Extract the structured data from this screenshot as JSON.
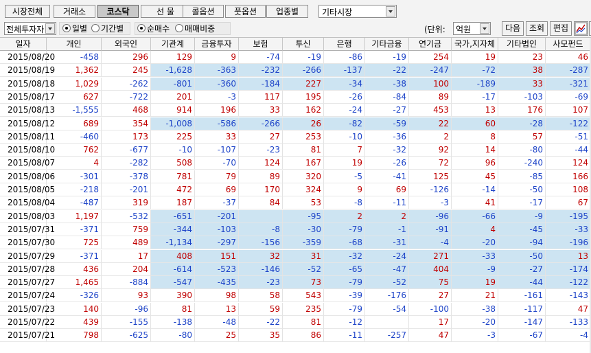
{
  "tabs": [
    "시장전체",
    "거래소",
    "코스닥",
    "선  물",
    "콜옵션",
    "풋옵션",
    "업종별"
  ],
  "active_tab": 2,
  "market_select": "기타시장",
  "investor_select": "전체투자자",
  "period_options": [
    "일별",
    "기간별"
  ],
  "period_selected": 0,
  "measure_options": [
    "순매수",
    "매매비중"
  ],
  "measure_selected": 0,
  "unit_label": "(단위:",
  "unit_select": "억원",
  "buttons": {
    "next": "다음",
    "query": "조회",
    "edit": "편집"
  },
  "icons": [
    "chart-icon",
    "grid-icon"
  ],
  "columns": [
    "일자",
    "개인",
    "외국인",
    "기관계",
    "금융투자",
    "보험",
    "투신",
    "은행",
    "기타금융",
    "연기금",
    "국가,지자체",
    "기타법인",
    "사모펀드"
  ],
  "rows": [
    {
      "date": "2015/08/20",
      "v": [
        "-458",
        "296",
        "129",
        "9",
        "-74",
        "-19",
        "-86",
        "-19",
        "254",
        "19",
        "23",
        "46"
      ],
      "hl": []
    },
    {
      "date": "2015/08/19",
      "v": [
        "1,362",
        "245",
        "-1,628",
        "-363",
        "-232",
        "-266",
        "-137",
        "-22",
        "-247",
        "-72",
        "38",
        "-287"
      ],
      "hl": [
        2,
        3,
        4,
        5,
        6,
        7,
        8,
        9,
        10,
        11
      ]
    },
    {
      "date": "2015/08/18",
      "v": [
        "1,029",
        "-262",
        "-801",
        "-360",
        "-184",
        "227",
        "-34",
        "-38",
        "100",
        "-189",
        "33",
        "-321"
      ],
      "hl": [
        2,
        3,
        4,
        5,
        6,
        7,
        8,
        9,
        10,
        11
      ]
    },
    {
      "date": "2015/08/17",
      "v": [
        "627",
        "-722",
        "201",
        "-3",
        "117",
        "195",
        "-26",
        "-84",
        "89",
        "-17",
        "-103",
        "-69"
      ],
      "hl": []
    },
    {
      "date": "2015/08/13",
      "v": [
        "-1,555",
        "468",
        "914",
        "196",
        "33",
        "162",
        "-24",
        "-27",
        "453",
        "13",
        "176",
        "107"
      ],
      "hl": []
    },
    {
      "date": "2015/08/12",
      "v": [
        "689",
        "354",
        "-1,008",
        "-586",
        "-266",
        "26",
        "-82",
        "-59",
        "22",
        "60",
        "-28",
        "-122"
      ],
      "hl": [
        2,
        3,
        4,
        5,
        6,
        7,
        8,
        9,
        10,
        11
      ]
    },
    {
      "date": "2015/08/11",
      "v": [
        "-460",
        "173",
        "225",
        "33",
        "27",
        "253",
        "-10",
        "-36",
        "2",
        "8",
        "57",
        "-51"
      ],
      "hl": []
    },
    {
      "date": "2015/08/10",
      "v": [
        "762",
        "-677",
        "-10",
        "-107",
        "-23",
        "81",
        "7",
        "-32",
        "92",
        "14",
        "-80",
        "-44"
      ],
      "hl": []
    },
    {
      "date": "2015/08/07",
      "v": [
        "4",
        "-282",
        "508",
        "-70",
        "124",
        "167",
        "19",
        "-26",
        "72",
        "96",
        "-240",
        "124"
      ],
      "hl": []
    },
    {
      "date": "2015/08/06",
      "v": [
        "-301",
        "-378",
        "781",
        "79",
        "89",
        "320",
        "-5",
        "-41",
        "125",
        "45",
        "-85",
        "166"
      ],
      "hl": []
    },
    {
      "date": "2015/08/05",
      "v": [
        "-218",
        "-201",
        "472",
        "69",
        "170",
        "324",
        "9",
        "69",
        "-126",
        "-14",
        "-50",
        "108"
      ],
      "hl": []
    },
    {
      "date": "2015/08/04",
      "v": [
        "-487",
        "319",
        "187",
        "-37",
        "84",
        "53",
        "-8",
        "-11",
        "-3",
        "41",
        "-17",
        "67"
      ],
      "hl": []
    },
    {
      "date": "2015/08/03",
      "v": [
        "1,197",
        "-532",
        "-651",
        "-201",
        "",
        "-95",
        "2",
        "2",
        "-96",
        "-66",
        "-9",
        "-195"
      ],
      "hl": [
        2,
        3,
        4,
        5,
        6,
        7,
        8,
        9,
        10,
        11
      ]
    },
    {
      "date": "2015/07/31",
      "v": [
        "-371",
        "759",
        "-344",
        "-103",
        "-8",
        "-30",
        "-79",
        "-1",
        "-91",
        "4",
        "-45",
        "-33"
      ],
      "hl": [
        2,
        3,
        4,
        5,
        6,
        7,
        8,
        9,
        10,
        11
      ]
    },
    {
      "date": "2015/07/30",
      "v": [
        "725",
        "489",
        "-1,134",
        "-297",
        "-156",
        "-359",
        "-68",
        "-31",
        "-4",
        "-20",
        "-94",
        "-196"
      ],
      "hl": [
        2,
        3,
        4,
        5,
        6,
        7,
        8,
        9,
        10,
        11
      ]
    },
    {
      "date": "2015/07/29",
      "v": [
        "-371",
        "17",
        "408",
        "151",
        "32",
        "31",
        "-32",
        "-24",
        "271",
        "-33",
        "-50",
        "13"
      ],
      "hl": [
        2,
        3,
        4,
        5,
        6,
        7,
        8,
        9,
        10,
        11
      ]
    },
    {
      "date": "2015/07/28",
      "v": [
        "436",
        "204",
        "-614",
        "-523",
        "-146",
        "-52",
        "-65",
        "-47",
        "404",
        "-9",
        "-27",
        "-174"
      ],
      "hl": [
        2,
        3,
        4,
        5,
        6,
        7,
        8,
        9,
        10,
        11
      ]
    },
    {
      "date": "2015/07/27",
      "v": [
        "1,465",
        "-884",
        "-547",
        "-435",
        "-23",
        "73",
        "-79",
        "-52",
        "75",
        "19",
        "-44",
        "-122"
      ],
      "hl": [
        2,
        3,
        4,
        5,
        6,
        7,
        8,
        9,
        10,
        11
      ]
    },
    {
      "date": "2015/07/24",
      "v": [
        "-326",
        "93",
        "390",
        "98",
        "58",
        "543",
        "-39",
        "-176",
        "27",
        "21",
        "-161",
        "-143"
      ],
      "hl": []
    },
    {
      "date": "2015/07/23",
      "v": [
        "140",
        "-96",
        "81",
        "13",
        "59",
        "235",
        "-79",
        "-54",
        "-100",
        "-38",
        "-117",
        "47"
      ],
      "hl": []
    },
    {
      "date": "2015/07/22",
      "v": [
        "439",
        "-155",
        "-138",
        "-48",
        "-22",
        "81",
        "-12",
        "",
        "17",
        "-20",
        "-147",
        "-133"
      ],
      "hl": []
    },
    {
      "date": "2015/07/21",
      "v": [
        "798",
        "-625",
        "-80",
        "25",
        "35",
        "86",
        "-11",
        "-257",
        "47",
        "-3",
        "-67",
        "-4"
      ],
      "hl": []
    }
  ],
  "colors": {
    "positive": "#c00000",
    "negative": "#1e44c8",
    "highlight": "#cde4f2"
  }
}
